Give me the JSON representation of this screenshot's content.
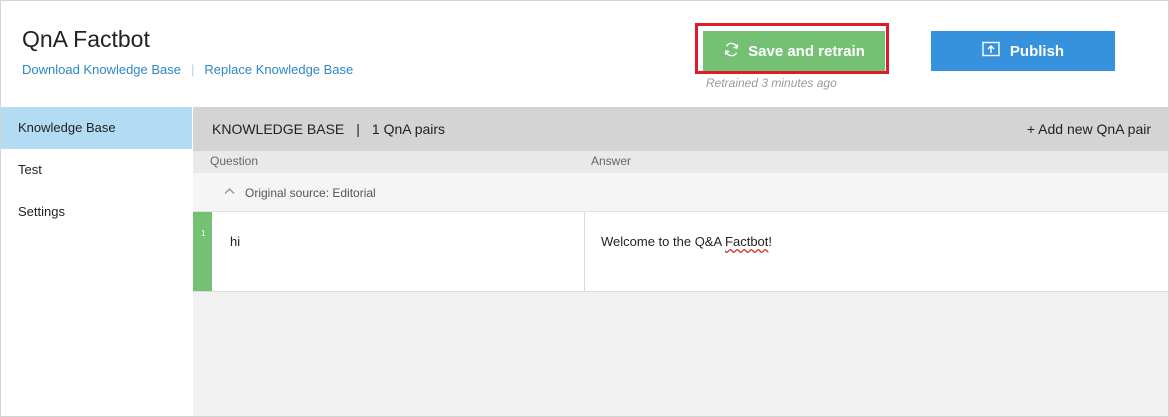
{
  "app": {
    "title": "QnA Factbot",
    "links": {
      "download": "Download Knowledge Base",
      "separator": "|",
      "replace": "Replace Knowledge Base"
    }
  },
  "toolbar": {
    "save_retrain_label": "Save and retrain",
    "retrained_status": "Retrained 3 minutes ago",
    "publish_label": "Publish"
  },
  "sidebar": {
    "items": [
      {
        "label": "Knowledge Base",
        "active": true
      },
      {
        "label": "Test",
        "active": false
      },
      {
        "label": "Settings",
        "active": false
      }
    ]
  },
  "kb": {
    "title": "KNOWLEDGE BASE",
    "separator": "|",
    "count": "1 QnA pairs",
    "add_label": "+ Add new QnA pair",
    "columns": {
      "question": "Question",
      "answer": "Answer"
    },
    "source": "Original source: Editorial",
    "rows": [
      {
        "num": "1",
        "question": "hi",
        "answer_prefix": "Welcome to the Q&A ",
        "answer_flagged": "Factbot",
        "answer_suffix": "!"
      }
    ]
  },
  "colors": {
    "accent_green": "#74c174",
    "accent_blue": "#3792de",
    "highlight_red": "#e0192b",
    "sidebar_active": "#b3dcf4"
  },
  "icons": {
    "retrain": "refresh-icon",
    "publish": "upload-icon",
    "source_toggle": "chevron-up-icon"
  }
}
